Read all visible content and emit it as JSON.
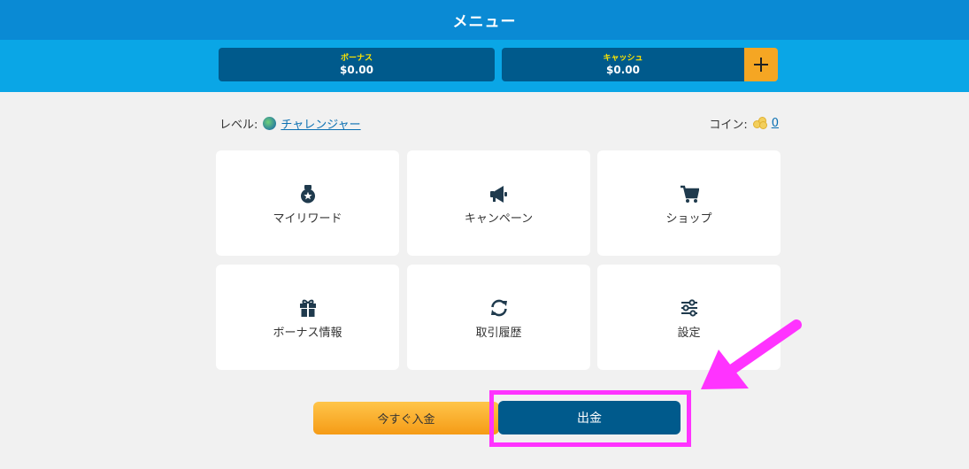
{
  "header": {
    "title": "メニュー"
  },
  "balances": {
    "bonus": {
      "label": "ボーナス",
      "value": "$0.00"
    },
    "cash": {
      "label": "キャッシュ",
      "value": "$0.00"
    },
    "add_icon": "plus-icon"
  },
  "status": {
    "level_label": "レベル:",
    "level_value": "チャレンジャー",
    "coin_label": "コイン:",
    "coin_value": "0"
  },
  "menu": {
    "items": [
      {
        "label": "マイリワード",
        "icon": "reward-medal-icon"
      },
      {
        "label": "キャンペーン",
        "icon": "megaphone-icon"
      },
      {
        "label": "ショップ",
        "icon": "shopping-cart-icon"
      },
      {
        "label": "ボーナス情報",
        "icon": "gift-icon"
      },
      {
        "label": "取引履歴",
        "icon": "sync-arrows-icon"
      },
      {
        "label": "設定",
        "icon": "sliders-icon"
      }
    ]
  },
  "actions": {
    "deposit_label": "今すぐ入金",
    "withdraw_label": "出金"
  },
  "colors": {
    "header": "#0a8ad4",
    "balance_bar": "#0aa6e6",
    "dark_blue": "#005a8c",
    "orange": "#f5a623",
    "highlight": "#ff33ff"
  }
}
